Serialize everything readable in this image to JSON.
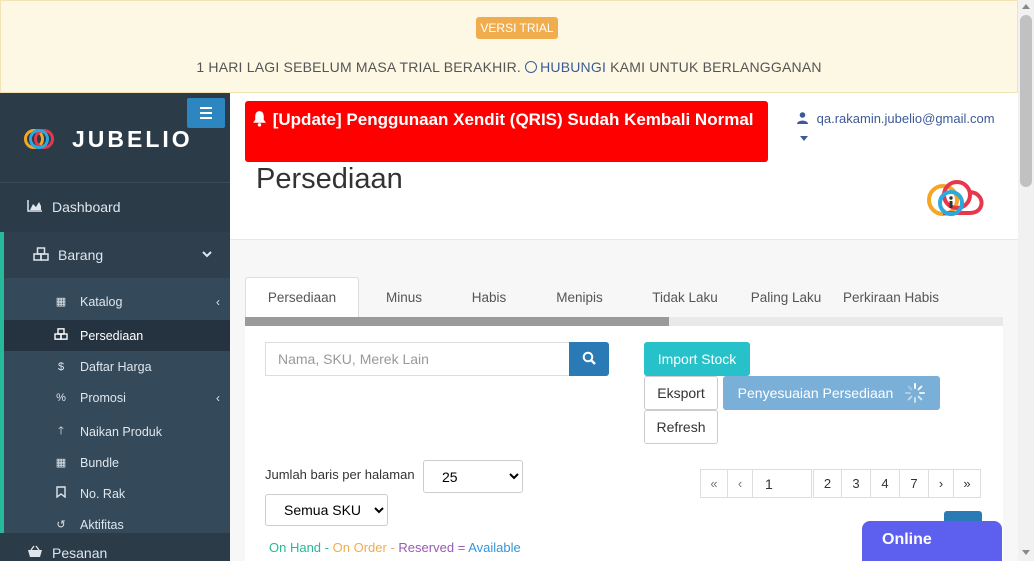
{
  "trial": {
    "badge": "VERSI TRIAL",
    "text_before": "1 HARI LAGI SEBELUM MASA TRIAL BERAKHIR.",
    "link": "HUBUNGI",
    "text_after": "KAMI UNTUK BERLANGGANAN"
  },
  "brand": {
    "name": "JUBELIO"
  },
  "sidebar": {
    "dashboard": "Dashboard",
    "barang": "Barang",
    "submenu": [
      {
        "label": "Katalog",
        "icon": "grid-icon"
      },
      {
        "label": "Persediaan",
        "icon": "cubes-icon"
      },
      {
        "label": "Daftar Harga",
        "icon": "dollar-icon"
      },
      {
        "label": "Promosi",
        "icon": "percent-icon"
      },
      {
        "label": "Naikan Produk",
        "icon": "arrow-up-icon"
      },
      {
        "label": "Bundle",
        "icon": "grid-icon"
      },
      {
        "label": "No. Rak",
        "icon": "bookmark-icon"
      },
      {
        "label": "Aktifitas",
        "icon": "history-icon"
      }
    ],
    "pesanan": "Pesanan"
  },
  "header": {
    "announcement": "[Update] Penggunaan Xendit (QRIS) Sudah Kembali Normal",
    "user_email": "qa.rakamin.jubelio@gmail.com",
    "page_title": "Persediaan"
  },
  "tabs": [
    "Persediaan",
    "Minus",
    "Habis",
    "Menipis",
    "Tidak Laku",
    "Paling Laku",
    "Perkiraan Habis"
  ],
  "toolbar": {
    "search_placeholder": "Nama, SKU, Merek Lain",
    "import": "Import Stock",
    "eksport": "Eksport",
    "penyesuaian": "Penyesuaian Persediaan",
    "refresh": "Refresh"
  },
  "list_controls": {
    "rows_label": "Jumlah baris per halaman",
    "rows_value": "25",
    "sku_value": "Semua SKU"
  },
  "pagination": {
    "first": "«",
    "prev": "‹",
    "current": "1",
    "pages": [
      "2",
      "3",
      "4",
      "7"
    ],
    "next": "›",
    "last": "»"
  },
  "legend": {
    "on_hand": "On Hand",
    "minus": "-",
    "on_order": "On Order",
    "minus2": "-",
    "reserved": "Reserved",
    "equals": "=",
    "available": "Available"
  },
  "colors": {
    "on_hand": "#26b99a",
    "on_order": "#f0ad4e",
    "reserved": "#9b59b6",
    "available": "#3498db",
    "announcement_bg": "#ff0000",
    "accent": "#2a7ab5"
  },
  "online": "Online"
}
